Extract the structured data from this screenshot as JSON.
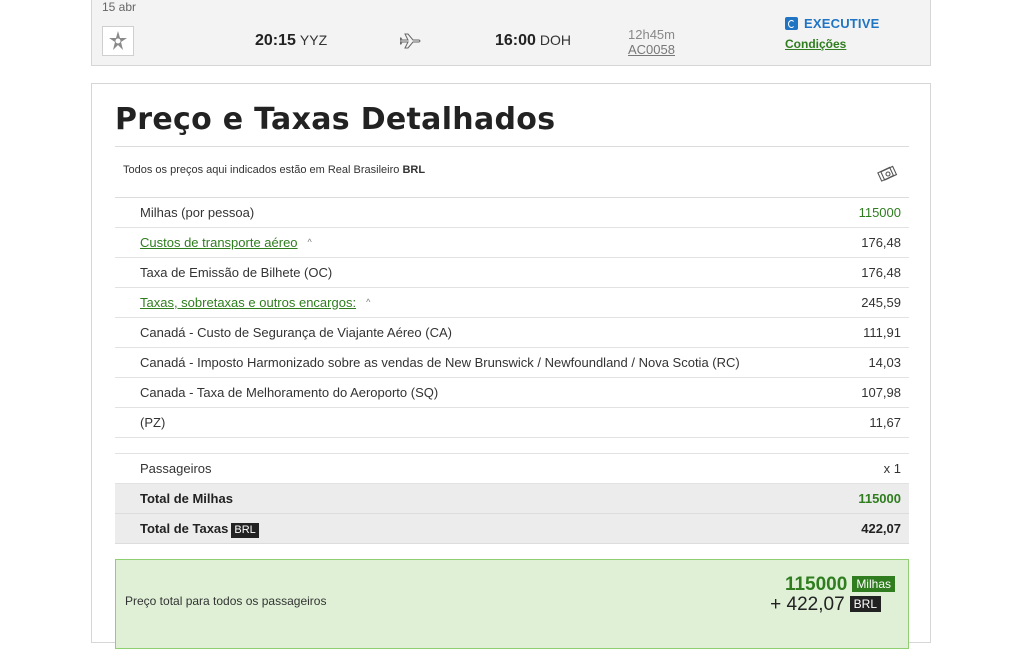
{
  "flight": {
    "date": "15 abr",
    "departure_time": "20:15",
    "departure_airport": "YYZ",
    "arrival_time": "16:00",
    "arrival_airport": "DOH",
    "duration": "12h45m",
    "flight_code": "AC0058",
    "cabin": "EXECUTIVE",
    "conditions_link": "Condições",
    "accent_color": "#1f74c4"
  },
  "pricing": {
    "title": "Preço e Taxas Detalhados",
    "currency_note_prefix": "Todos os preços aqui indicados estão em Real Brasileiro",
    "currency_code": "BRL",
    "rows": [
      {
        "label": "Milhas (por pessoa)",
        "value": "115000"
      },
      {
        "label": "Custos de transporte aéreo",
        "value": "176,48"
      },
      {
        "label": "Taxa de Emissão de Bilhete (OC)",
        "value": "176,48"
      },
      {
        "label": "Taxas, sobretaxas e outros encargos:",
        "value": "245,59"
      },
      {
        "label": "Canadá - Custo de Segurança de Viajante Aéreo (CA)",
        "value": "111,91"
      },
      {
        "label": "Canadá - Imposto Harmonizado sobre as vendas de New Brunswick / Newfoundland / Nova Scotia (RC)",
        "value": "14,03"
      },
      {
        "label": "Canada - Taxa de Melhoramento do Aeroporto (SQ)",
        "value": "107,98"
      },
      {
        "label": "(PZ)",
        "value": "11,67"
      }
    ],
    "passengers_label": "Passageiros",
    "passengers_value": "x 1",
    "total_miles_label": "Total de Milhas",
    "total_miles_value": "115000",
    "total_taxes_label": "Total de Taxas",
    "total_taxes_tag": "BRL",
    "total_taxes_value": "422,07",
    "grand_total_label": "Preço total para todos os passageiros",
    "grand_total_miles": "115000",
    "grand_total_miles_tag": "Milhas",
    "grand_total_taxes": "+ 422,07",
    "grand_total_taxes_tag": "BRL",
    "link_color": "#2f7d1f"
  }
}
